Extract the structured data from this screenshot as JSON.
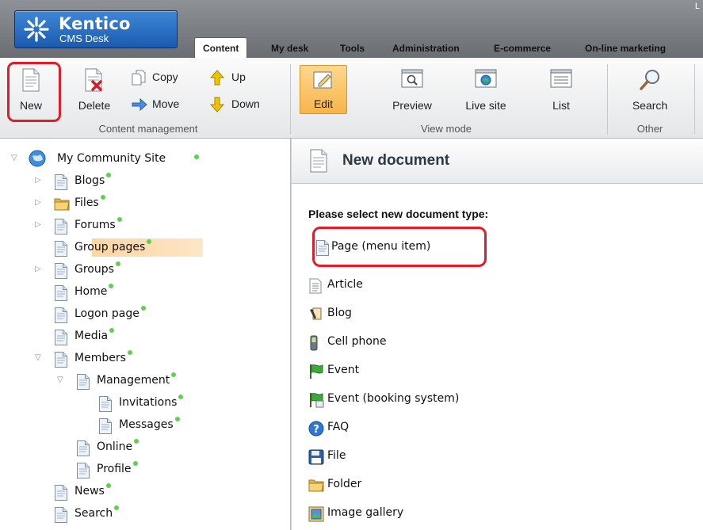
{
  "app": {
    "brand": "Kentico",
    "subtitle": "CMS Desk",
    "corner_link": "L"
  },
  "tabs": [
    {
      "label": "Content",
      "active": true
    },
    {
      "label": "My desk",
      "active": false
    },
    {
      "label": "Tools",
      "active": false
    },
    {
      "label": "Administration",
      "active": false
    },
    {
      "label": "E-commerce",
      "active": false
    },
    {
      "label": "On-line marketing",
      "active": false
    }
  ],
  "ribbon": {
    "content_management": {
      "label": "Content management",
      "new": "New",
      "delete": "Delete",
      "copy": "Copy",
      "move": "Move",
      "up": "Up",
      "down": "Down"
    },
    "view_mode": {
      "label": "View mode",
      "edit": "Edit",
      "preview": "Preview",
      "live_site": "Live site",
      "list": "List",
      "selected": "Edit"
    },
    "other": {
      "label": "Other",
      "search": "Search"
    }
  },
  "tree": {
    "root": "My Community Site",
    "items": [
      {
        "label": "Blogs",
        "icon": "page-icon"
      },
      {
        "label": "Files",
        "icon": "folder-icon"
      },
      {
        "label": "Forums",
        "icon": "page-icon"
      },
      {
        "label": "Group pages",
        "icon": "page-icon"
      },
      {
        "label": "Groups",
        "icon": "page-icon"
      },
      {
        "label": "Home",
        "icon": "page-icon"
      },
      {
        "label": "Logon page",
        "icon": "page-icon"
      },
      {
        "label": "Media",
        "icon": "page-icon"
      },
      {
        "label": "Members",
        "icon": "page-icon"
      },
      {
        "label": "Management",
        "icon": "page-icon",
        "selected": true
      },
      {
        "label": "Invitations",
        "icon": "page-icon"
      },
      {
        "label": "Messages",
        "icon": "page-icon"
      },
      {
        "label": "Online",
        "icon": "page-icon"
      },
      {
        "label": "Profile",
        "icon": "page-icon"
      },
      {
        "label": "News",
        "icon": "page-icon"
      },
      {
        "label": "Search",
        "icon": "page-icon"
      }
    ],
    "status_color": "#5bd24a"
  },
  "panel": {
    "title": "New document",
    "prompt": "Please select new document type:",
    "types": [
      {
        "label": "Page (menu item)",
        "icon": "page-icon"
      },
      {
        "label": "Article",
        "icon": "article-icon"
      },
      {
        "label": "Blog",
        "icon": "blog-icon"
      },
      {
        "label": "Cell phone",
        "icon": "cell-phone-icon"
      },
      {
        "label": "Event",
        "icon": "flag-icon"
      },
      {
        "label": "Event (booking system)",
        "icon": "flag-booking-icon"
      },
      {
        "label": "FAQ",
        "icon": "help-icon"
      },
      {
        "label": "File",
        "icon": "floppy-icon"
      },
      {
        "label": "Folder",
        "icon": "folder-icon"
      },
      {
        "label": "Image gallery",
        "icon": "image-gallery-icon"
      }
    ]
  },
  "colors": {
    "highlight": "#e01d2b",
    "brand_blue": "#1a5bb0",
    "selected_bg": "#fbd6a4"
  }
}
